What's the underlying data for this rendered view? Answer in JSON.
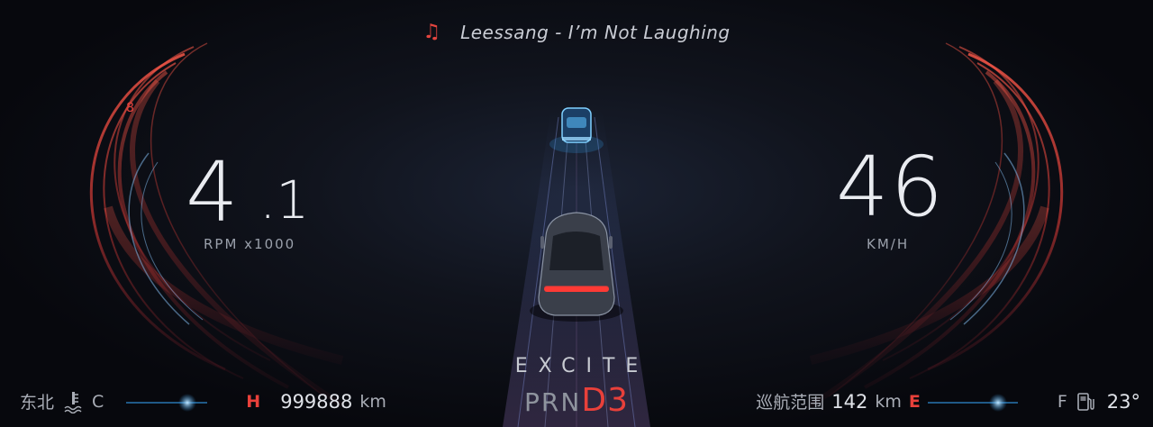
{
  "media": {
    "icon": "music-note-icon",
    "song": "Leessang - I’m Not Laughing"
  },
  "tachometer": {
    "redline_mark": "8",
    "value_int": "4",
    "value_dec": ".1",
    "unit": "RPM x1000"
  },
  "speedometer": {
    "value": "46",
    "unit": "KM/H"
  },
  "drive": {
    "mode": "EXCITE",
    "gears": [
      "P",
      "R",
      "N"
    ],
    "active_gear": "D3"
  },
  "status_left": {
    "direction": "东北",
    "temp_icon": "coolant-temperature-icon",
    "temp_cold": "C",
    "temp_hot": "H",
    "odometer": "999888",
    "odometer_unit": "km"
  },
  "status_right": {
    "range_label": "巡航范围",
    "range_value": "142",
    "range_unit": "km",
    "fuel_empty": "E",
    "fuel_full": "F",
    "fuel_icon": "fuel-pump-icon",
    "outside_temp": "23°"
  },
  "colors": {
    "accent_red": "#e8403a",
    "accent_blue": "#4aa8e6",
    "background": "#07080d"
  }
}
